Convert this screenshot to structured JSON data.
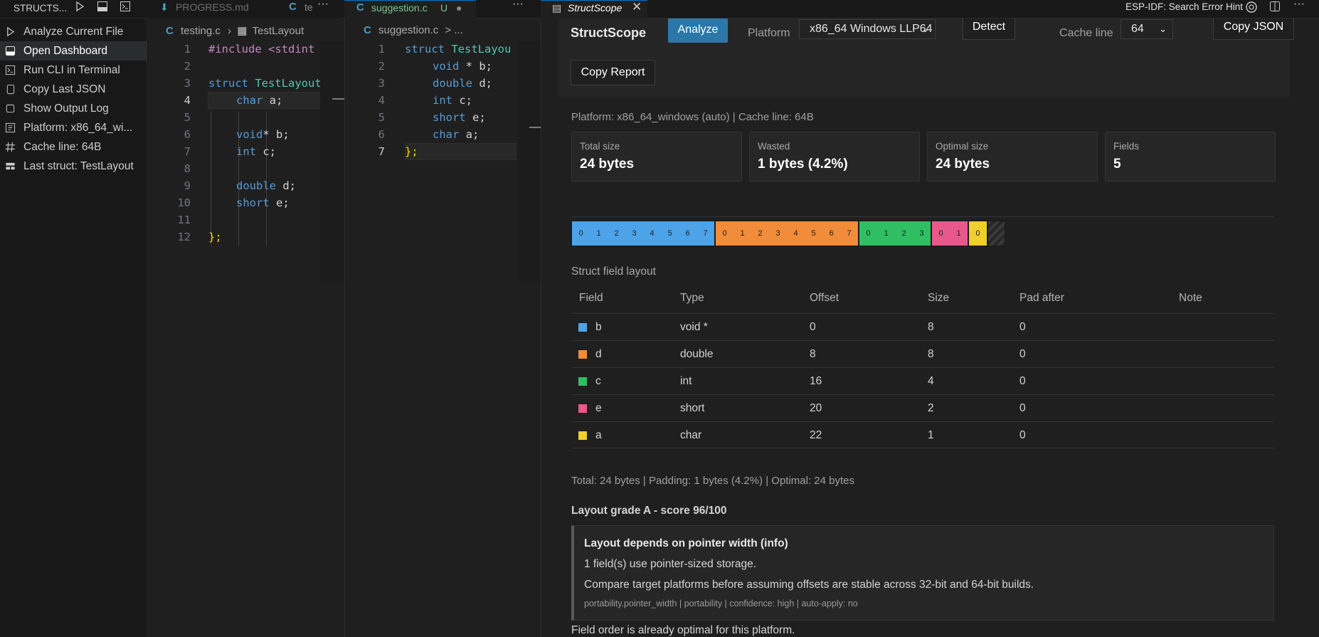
{
  "colors": {
    "ptr": "#4da3e8",
    "dbl": "#f08c3a",
    "int": "#2fbf62",
    "short": "#e8588b",
    "char": "#f0cf2a",
    "accent": "#2b78a8"
  },
  "topbar": {
    "sidebar_title": "STRUCTS...",
    "tab_progress": "PROGRESS.md",
    "tab_testing_trunc": "te",
    "tab_suggestion": "suggestion.c",
    "tab_suggestion_status": "U",
    "tab_structscope": "StructScope",
    "esp_hint": "ESP-IDF: Search Error Hint"
  },
  "sidebar": {
    "items": [
      {
        "label": "Analyze Current File",
        "icon": "play-icon"
      },
      {
        "label": "Open Dashboard",
        "icon": "dashboard-icon"
      },
      {
        "label": "Run CLI in Terminal",
        "icon": "terminal-icon"
      },
      {
        "label": "Copy Last JSON",
        "icon": "copy-icon"
      },
      {
        "label": "Show Output Log",
        "icon": "output-icon"
      },
      {
        "label": "Platform: x86_64_wi...",
        "icon": "platform-icon"
      },
      {
        "label": "Cache line: 64B",
        "icon": "hash-icon"
      },
      {
        "label": "Last struct: TestLayout",
        "icon": "struct-icon"
      }
    ]
  },
  "editor1": {
    "file": "testing.c",
    "symbol": "TestLayout",
    "line_numbers": [
      "1",
      "2",
      "3",
      "4",
      "5",
      "6",
      "7",
      "8",
      "9",
      "10",
      "11",
      "12"
    ],
    "l1": "#include <stdint",
    "l3_kw": "struct",
    "l3_name": "TestLayout",
    "l4_type": "char",
    "l4_rest": " a;",
    "l6_type": "void",
    "l6_rest": "* b;",
    "l7_type": "int",
    "l7_rest": " c;",
    "l9_type": "double",
    "l9_rest": " d;",
    "l10_type": "short",
    "l10_rest": " e;",
    "l12": "};"
  },
  "editor2": {
    "file": "suggestion.c",
    "crumb_rest": "> ...",
    "line_numbers": [
      "1",
      "2",
      "3",
      "4",
      "5",
      "6",
      "7"
    ],
    "l1_kw": "struct",
    "l1_name": "TestLayou",
    "l2_type": "void",
    "l2_rest": " * b;",
    "l3_type": "double",
    "l3_rest": " d;",
    "l4_type": "int",
    "l4_rest": " c;",
    "l5_type": "short",
    "l5_rest": " e;",
    "l6_type": "char",
    "l6_rest": " a;",
    "l7": "};"
  },
  "panel": {
    "brand": "StructScope",
    "analyze": "Analyze",
    "platform_label": "Platform",
    "platform_value": "x86_64 Windows LLP64",
    "detect": "Detect",
    "cache_label": "Cache line",
    "cache_value": "64",
    "copy_json": "Copy JSON",
    "copy_report": "Copy Report",
    "meta": "Platform: x86_64_windows (auto) | Cache line: 64B",
    "cards": [
      {
        "title": "Total size",
        "value": "24 bytes"
      },
      {
        "title": "Wasted",
        "value": "1 bytes (4.2%)"
      },
      {
        "title": "Optimal size",
        "value": "24 bytes"
      },
      {
        "title": "Fields",
        "value": "5"
      }
    ],
    "bar": {
      "seg_b": [
        "0",
        "1",
        "2",
        "3",
        "4",
        "5",
        "6",
        "7"
      ],
      "seg_d": [
        "0",
        "1",
        "2",
        "3",
        "4",
        "5",
        "6",
        "7"
      ],
      "seg_c": [
        "0",
        "1",
        "2",
        "3"
      ],
      "seg_e": [
        "0",
        "1"
      ],
      "seg_a": [
        "0"
      ],
      "padding_bytes": 1
    },
    "table_title": "Struct field layout",
    "headers": {
      "field": "Field",
      "type": "Type",
      "offset": "Offset",
      "size": "Size",
      "pad": "Pad after",
      "note": "Note"
    },
    "rows": [
      {
        "field": "b",
        "type": "void *",
        "offset": "0",
        "size": "8",
        "pad": "0"
      },
      {
        "field": "d",
        "type": "double",
        "offset": "8",
        "size": "8",
        "pad": "0"
      },
      {
        "field": "c",
        "type": "int",
        "offset": "16",
        "size": "4",
        "pad": "0"
      },
      {
        "field": "e",
        "type": "short",
        "offset": "20",
        "size": "2",
        "pad": "0"
      },
      {
        "field": "a",
        "type": "char",
        "offset": "22",
        "size": "1",
        "pad": "0"
      }
    ],
    "summary": "Total: 24 bytes | Padding: 1 bytes (4.2%) | Optimal: 24 bytes",
    "grade": "Layout grade A - score 96/100",
    "finding": {
      "title": "Layout depends on pointer width (info)",
      "line1": "1 field(s) use pointer-sized storage.",
      "line2": "Compare target platforms before assuming offsets are stable across 32-bit and 64-bit builds.",
      "meta": "portability.pointer_width | portability | confidence: high | auto-apply: no"
    },
    "optimal_note": "Field order is already optimal for this platform."
  }
}
